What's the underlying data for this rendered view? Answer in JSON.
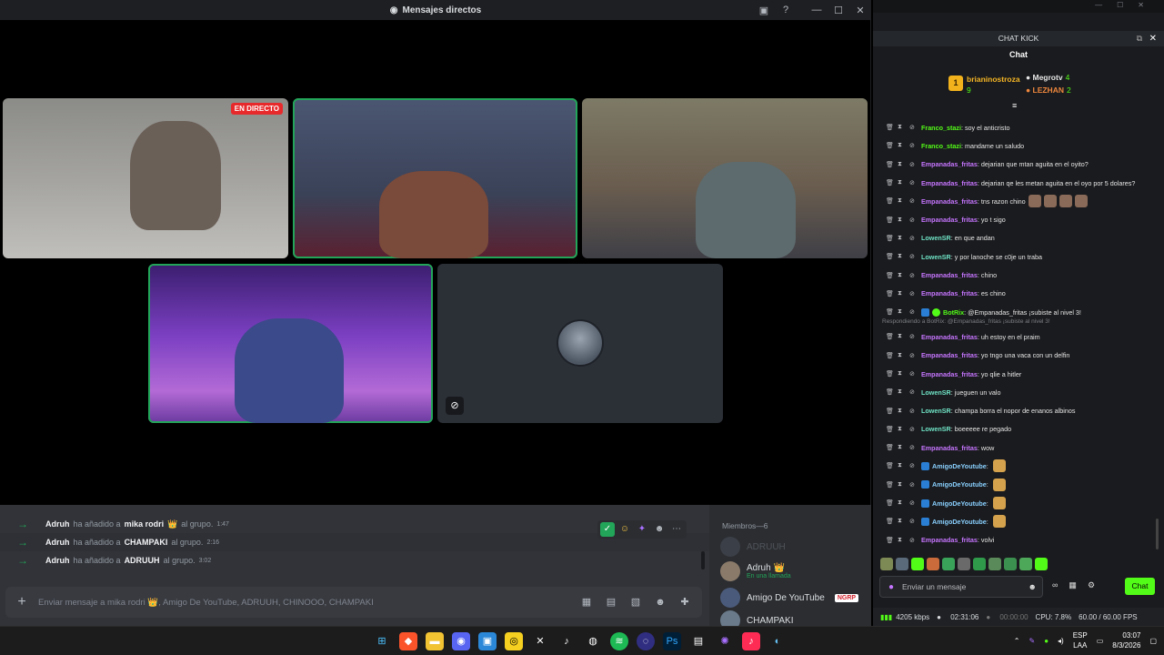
{
  "discord": {
    "window_title": "Mensajes directos",
    "live_badge": "EN DIRECTO",
    "system_messages": [
      {
        "actor": "Adruh",
        "action": "ha añadido a",
        "target": "mika rodri",
        "crown": "👑",
        "suffix": "al grupo.",
        "time": "1:47"
      },
      {
        "actor": "Adruh",
        "action": "ha añadido a",
        "target": "CHAMPAKI",
        "crown": "",
        "suffix": "al grupo.",
        "time": "2:16"
      },
      {
        "actor": "Adruh",
        "action": "ha añadido a",
        "target": "ADRUUH",
        "crown": "",
        "suffix": "al grupo.",
        "time": "3:02"
      }
    ],
    "composer_placeholder": "Enviar mensaje a mika rodri 👑, Amigo De YouTube, ADRUUH, CHINOOO, CHAMPAKI",
    "members_header": "Miembros—6",
    "members": [
      {
        "name": "ADRUUH",
        "sub": "",
        "tag": ""
      },
      {
        "name": "Adruh 👑",
        "sub": "En una llamada",
        "tag": ""
      },
      {
        "name": "Amigo De YouTube",
        "sub": "",
        "tag": "NGRP"
      },
      {
        "name": "CHAMPAKI",
        "sub": "",
        "tag": ""
      }
    ]
  },
  "kick": {
    "window_title": "CHAT KICK",
    "heading": "Chat",
    "leaderboard": {
      "first": {
        "rank": "1",
        "name": "brianinostroza",
        "count": "9"
      },
      "second": {
        "name": "Megrotv",
        "count": "4"
      },
      "third": {
        "name": "LEZHAN",
        "count": "2"
      }
    },
    "messages": [
      {
        "user": "Franco_stazi",
        "color": "green",
        "text": "soy el anticristo"
      },
      {
        "user": "Franco_stazi",
        "color": "green",
        "text": "mandame un saludo"
      },
      {
        "user": "Empanadas_fritas",
        "color": "purple",
        "text": "dejarian que mtan aguita en el oyito?"
      },
      {
        "user": "Empanadas_fritas",
        "color": "purple",
        "text": "dejarian qe les metan aguita en el oyo por 5 dolares?"
      },
      {
        "user": "Empanadas_fritas",
        "color": "purple",
        "text": "tns razon chino",
        "emotes": 4
      },
      {
        "user": "Empanadas_fritas",
        "color": "purple",
        "text": "yo t sigo"
      },
      {
        "user": "LowenSR",
        "color": "teal",
        "text": "en que andan"
      },
      {
        "user": "LowenSR",
        "color": "teal",
        "text": "y por lanoche se c0je un traba"
      },
      {
        "user": "Empanadas_fritas",
        "color": "purple",
        "text": "chino"
      },
      {
        "user": "Empanadas_fritas",
        "color": "purple",
        "text": "es chino"
      },
      {
        "user": "BotRix",
        "color": "green",
        "text": "@Empanadas_fritas ¡subiste al nivel 3!",
        "bot": true
      },
      {
        "user": "Empanadas_fritas",
        "color": "purple",
        "text": "uh estoy en el praim",
        "reply": "Respondiendo a BotRix: @Empanadas_fritas ¡subiste al nivel 3!"
      },
      {
        "user": "Empanadas_fritas",
        "color": "purple",
        "text": "yo tngo una vaca con un delfin"
      },
      {
        "user": "Empanadas_fritas",
        "color": "purple",
        "text": "yo qlie a hitler"
      },
      {
        "user": "LowenSR",
        "color": "teal",
        "text": "jueguen un valo"
      },
      {
        "user": "LowenSR",
        "color": "teal",
        "text": "champa borra el nopor de enanos albinos"
      },
      {
        "user": "LowenSR",
        "color": "teal",
        "text": "boeeeee re pegado"
      },
      {
        "user": "Empanadas_fritas",
        "color": "purple",
        "text": "wow"
      },
      {
        "user": "AmigoDeYoutube",
        "color": "blue",
        "text": "",
        "emotes": 1,
        "sub": true
      },
      {
        "user": "AmigoDeYoutube",
        "color": "blue",
        "text": "",
        "emotes": 1,
        "sub": true
      },
      {
        "user": "AmigoDeYoutube",
        "color": "blue",
        "text": "",
        "emotes": 1,
        "sub": true
      },
      {
        "user": "AmigoDeYoutube",
        "color": "blue",
        "text": "",
        "emotes": 1,
        "sub": true
      },
      {
        "user": "Empanadas_fritas",
        "color": "purple",
        "text": "volvi"
      }
    ],
    "input_placeholder": "Enviar un mensaje",
    "send_label": "Chat"
  },
  "obs": {
    "bitrate": "4205 kbps",
    "live_time": "02:31:06",
    "rec_time": "00:00:00",
    "cpu": "CPU: 7.8%",
    "fps": "60.00 / 60.00 FPS"
  },
  "taskbar": {
    "lang_1": "ESP",
    "lang_2": "LAA",
    "time": "03:07",
    "date": "8/3/2026"
  }
}
